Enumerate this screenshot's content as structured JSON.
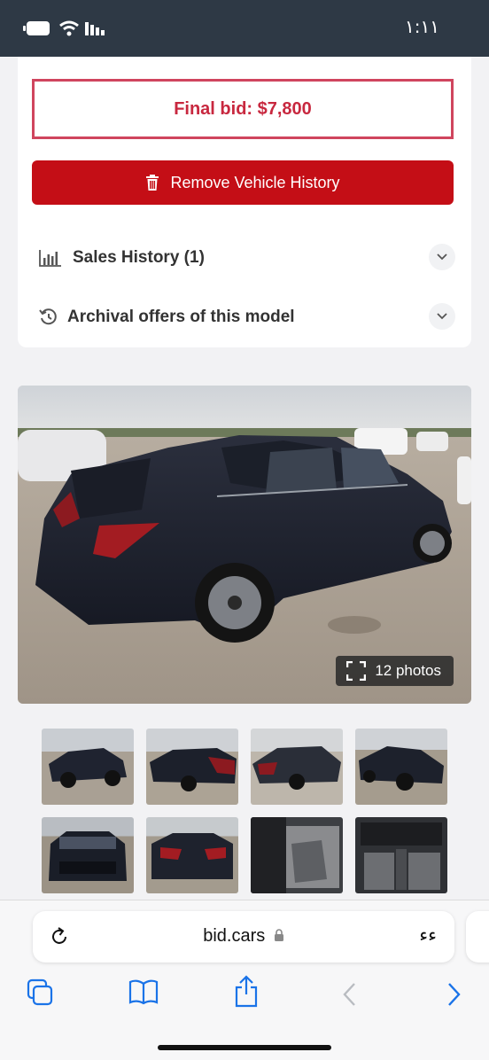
{
  "status_bar": {
    "time": "١:١١",
    "icons": [
      "battery-icon",
      "wifi-icon",
      "signal-icon"
    ]
  },
  "auction_card": {
    "final_bid": "Final bid: $7,800",
    "remove_button_label": "Remove Vehicle History",
    "sales_history_label": "Sales History (1)",
    "archival_offers_label": "Archival offers of this model"
  },
  "gallery": {
    "photos_badge": "12 photos",
    "thumbnail_count": 8
  },
  "browser": {
    "url": "bid.cars",
    "aa_label": "ﺀﺀ"
  },
  "colors": {
    "final_bid": "#c8283f",
    "remove_button": "#c40e16",
    "status_bar": "#2e3945",
    "browser_accent": "#1a73e8"
  }
}
